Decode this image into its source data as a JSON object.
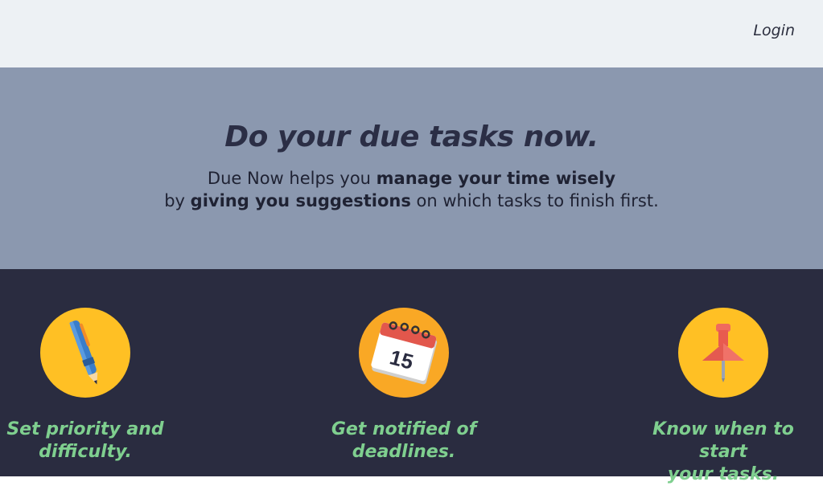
{
  "nav": {
    "login_label": "Login"
  },
  "hero": {
    "title": "Do your due tasks now.",
    "line1_prefix": "Due Now helps you ",
    "line1_bold": "manage your time wisely",
    "line2_prefix": "by ",
    "line2_bold": "giving you suggestions",
    "line2_suffix": " on which tasks to finish first."
  },
  "features": [
    {
      "icon": "pen-icon",
      "label_line1": "Set priority and",
      "label_line2": "difficulty."
    },
    {
      "icon": "calendar-icon",
      "calendar_number": "15",
      "label_line1": "Get notified of",
      "label_line2": "deadlines."
    },
    {
      "icon": "pushpin-icon",
      "label_line1": "Know when to start",
      "label_line2": "your tasks."
    }
  ],
  "colors": {
    "nav_bg": "#edf1f4",
    "hero_bg": "#8b98af",
    "features_bg": "#2a2c40",
    "feature_text": "#7fcf8f",
    "icon_circle": "#ffc024"
  }
}
